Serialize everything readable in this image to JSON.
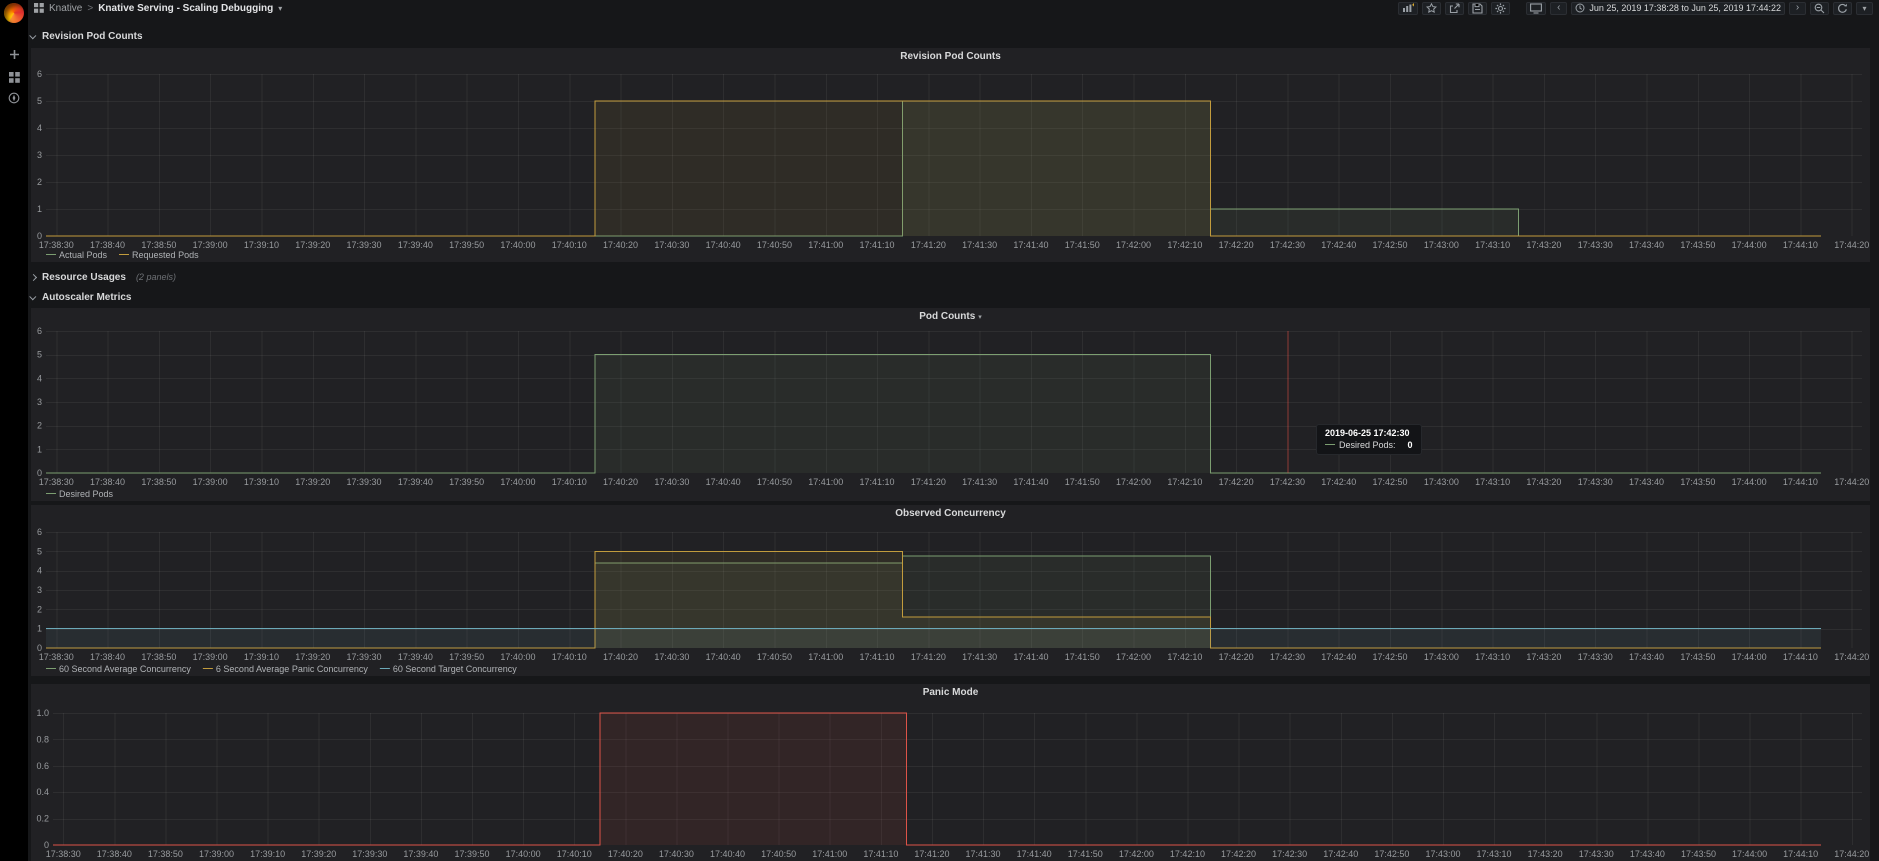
{
  "sidebar": {
    "icons": [
      "grafana-logo",
      "create-plus",
      "dashboards-grid",
      "explore-compass"
    ]
  },
  "navbar": {
    "breadcrumb": {
      "folder": "Knative",
      "separator": ">",
      "title": "Knative Serving - Scaling Debugging"
    },
    "toolbar": {
      "icons": [
        "add-panel",
        "star",
        "share",
        "save",
        "settings",
        "tv"
      ],
      "prev": "‹",
      "time_range": "Jun 25, 2019 17:38:28 to Jun 25, 2019 17:44:22",
      "next": "›"
    }
  },
  "rows": [
    {
      "label": "Revision Pod Counts",
      "collapsed": false
    },
    {
      "label": "Resource Usages",
      "note": "(2 panels)",
      "collapsed": true
    },
    {
      "label": "Autoscaler Metrics",
      "collapsed": false
    }
  ],
  "colors": {
    "green": "#7c9e71",
    "yellow": "#c29c3d",
    "blue": "#6ca9b8",
    "red": "#dd5348",
    "crosshair": "rgba(224,70,60,0.55)",
    "grid": "rgba(255,255,255,0.06)"
  },
  "x_axis": {
    "domain_s": [
      0,
      354
    ],
    "start_label_offset_s": 2,
    "step_s": 10,
    "series_end_s": 346,
    "labels": [
      "17:38:30",
      "17:38:40",
      "17:38:50",
      "17:39:00",
      "17:39:10",
      "17:39:20",
      "17:39:30",
      "17:39:40",
      "17:39:50",
      "17:40:00",
      "17:40:10",
      "17:40:20",
      "17:40:30",
      "17:40:40",
      "17:40:50",
      "17:41:00",
      "17:41:10",
      "17:41:20",
      "17:41:30",
      "17:41:40",
      "17:41:50",
      "17:42:00",
      "17:42:10",
      "17:42:20",
      "17:42:30",
      "17:42:40",
      "17:42:50",
      "17:43:00",
      "17:43:10",
      "17:43:20",
      "17:43:30",
      "17:43:40",
      "17:43:50",
      "17:44:00",
      "17:44:10",
      "17:44:20"
    ]
  },
  "chart_data": [
    {
      "type": "line",
      "title": "Revision Pod Counts",
      "ylim": [
        0,
        6
      ],
      "yticks": [
        "0",
        "1",
        "2",
        "3",
        "4",
        "5",
        "6"
      ],
      "grid": true,
      "legend_position": "bottom",
      "series": [
        {
          "name": "Actual Pods",
          "color_key": "green",
          "points": [
            [
              0,
              0
            ],
            [
              167,
              5
            ],
            [
              227,
              1
            ],
            [
              287,
              0
            ],
            [
              346,
              0
            ]
          ]
        },
        {
          "name": "Requested Pods",
          "color_key": "yellow",
          "points": [
            [
              0,
              0
            ],
            [
              107,
              5
            ],
            [
              227,
              0
            ],
            [
              346,
              0
            ]
          ]
        }
      ]
    },
    {
      "type": "line",
      "title": "Pod Counts",
      "has_menu_caret": true,
      "ylim": [
        0,
        6
      ],
      "yticks": [
        "0",
        "1",
        "2",
        "3",
        "4",
        "5",
        "6"
      ],
      "grid": true,
      "legend_position": "bottom",
      "series": [
        {
          "name": "Desired Pods",
          "color_key": "green",
          "points": [
            [
              0,
              0
            ],
            [
              107,
              5
            ],
            [
              227,
              0
            ],
            [
              346,
              0
            ]
          ]
        }
      ],
      "crosshair_t": 242,
      "tooltip": {
        "time": "2019-06-25 17:42:30",
        "series_label": "Desired Pods:",
        "value": "0"
      }
    },
    {
      "type": "line",
      "title": "Observed Concurrency",
      "ylim": [
        0,
        6
      ],
      "yticks": [
        "0",
        "1",
        "2",
        "3",
        "4",
        "5",
        "6"
      ],
      "grid": true,
      "legend_position": "bottom",
      "series": [
        {
          "name": "60 Second Average Concurrency",
          "color_key": "green",
          "points": [
            [
              0,
              0
            ],
            [
              107,
              4.4
            ],
            [
              167,
              4.75
            ],
            [
              227,
              0
            ],
            [
              346,
              0
            ]
          ]
        },
        {
          "name": "6 Second Average Panic Concurrency",
          "color_key": "yellow",
          "points": [
            [
              0,
              0
            ],
            [
              107,
              5
            ],
            [
              167,
              1.6
            ],
            [
              227,
              0
            ],
            [
              346,
              0
            ]
          ]
        },
        {
          "name": "60 Second Target Concurrency",
          "color_key": "blue",
          "points": [
            [
              0,
              1
            ],
            [
              346,
              1
            ]
          ]
        }
      ]
    },
    {
      "type": "line",
      "title": "Panic Mode",
      "ylim": [
        0,
        1
      ],
      "yticks": [
        "0",
        "0.2",
        "0.4",
        "0.6",
        "0.8",
        "1.0"
      ],
      "grid": true,
      "legend_position": "none",
      "series": [
        {
          "name": "Panic Mode",
          "color_key": "red",
          "points": [
            [
              0,
              0
            ],
            [
              107,
              1
            ],
            [
              167,
              0
            ],
            [
              346,
              0
            ]
          ]
        }
      ]
    }
  ]
}
